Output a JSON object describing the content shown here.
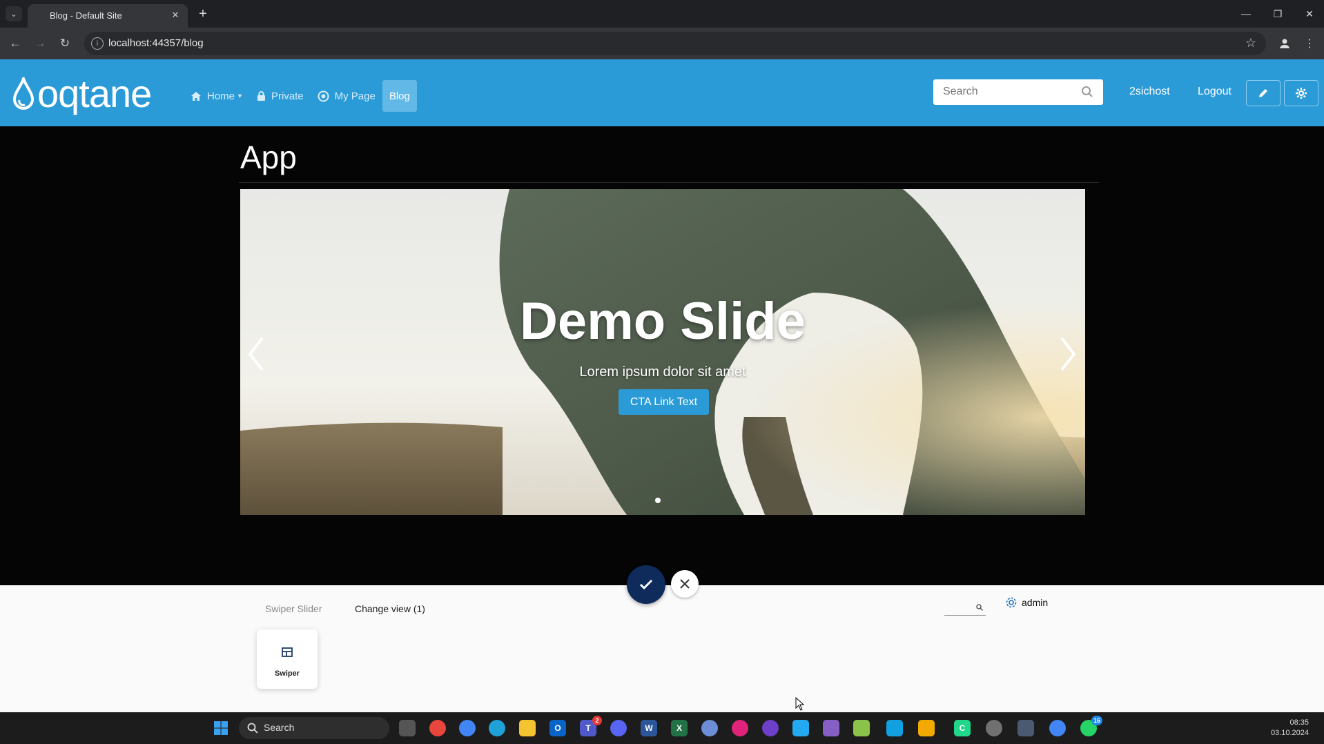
{
  "browser": {
    "tab_title": "Blog - Default Site",
    "tab_close_icon": "close-icon",
    "new_tab_icon": "plus-icon",
    "url": "localhost:44357/blog"
  },
  "header": {
    "logo_text": "oqtane",
    "menu": [
      {
        "label": "Home",
        "icon": "home-icon",
        "has_dropdown": true,
        "active": false
      },
      {
        "label": "Private",
        "icon": "lock-icon",
        "active": false
      },
      {
        "label": "My Page",
        "icon": "target-icon",
        "active": false
      },
      {
        "label": "Blog",
        "active": true
      }
    ],
    "search_placeholder": "Search",
    "user_link": "2sichost",
    "logout_label": "Logout",
    "accent_color": "#2b9bd8"
  },
  "page": {
    "title": "App",
    "slide": {
      "heading": "Demo Slide",
      "subtext": "Lorem ipsum dolor sit amet",
      "cta_label": "CTA Link Text"
    },
    "slide_count": 1,
    "active_slide": 1
  },
  "panel": {
    "tab_swiper": "Swiper Slider",
    "tab_change_view": "Change view (1)",
    "admin_label": "admin",
    "card_label": "Swiper"
  },
  "taskbar": {
    "search_label": "Search",
    "time": "08:35",
    "date": "03.10.2024",
    "teams_badge": "2",
    "whatsapp_badge": "16"
  }
}
